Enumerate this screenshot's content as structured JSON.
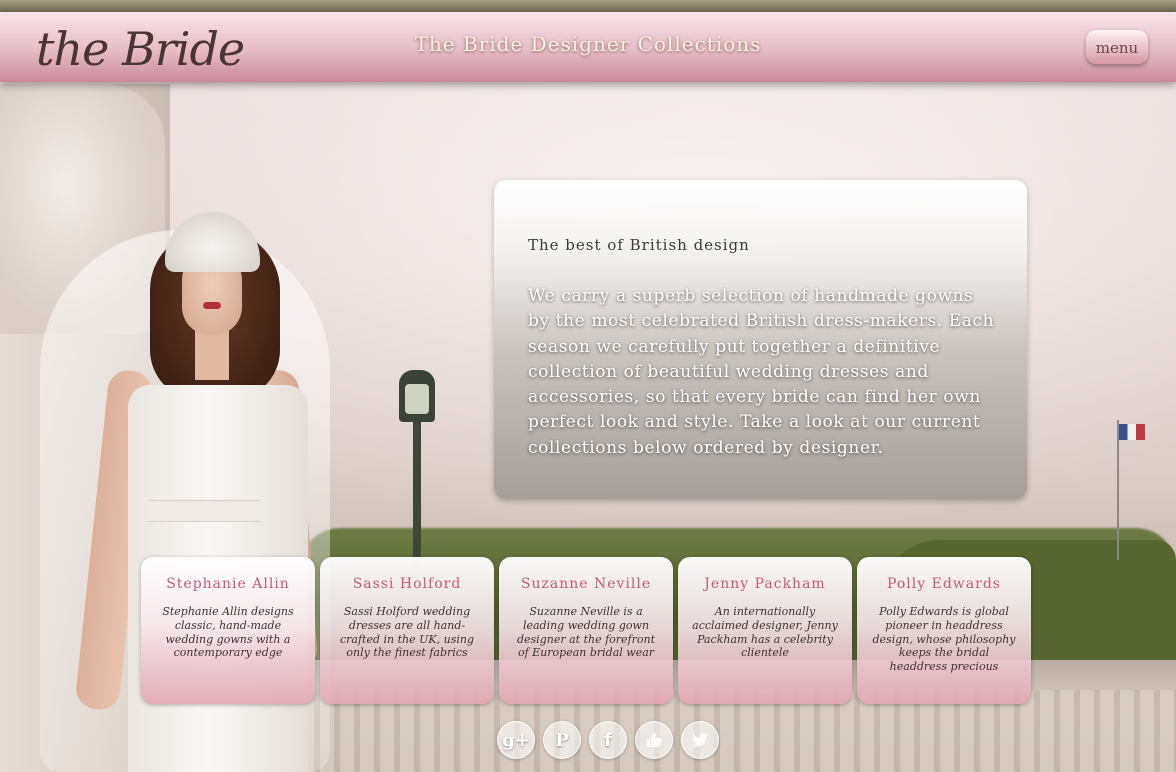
{
  "header": {
    "logo_text": "the Bride",
    "title": "The Bride Designer Collections",
    "menu_label": "menu"
  },
  "intro": {
    "heading": "The best of British design",
    "text": "We carry a superb selection of handmade gowns by the most celebrated British dress-makers. Each season we carefully put together a definitive collection of beautiful wedding dresses and accessories, so that every bride can find her own perfect look and style. Take a look at our current collections below ordered by designer."
  },
  "designers": [
    {
      "name": "Stephanie Allin",
      "description": "Stephanie Allin designs classic, hand-made wedding gowns with a contemporary edge"
    },
    {
      "name": "Sassi Holford",
      "description": "Sassi Holford wedding dresses are all hand-crafted in the UK, using only the finest fabrics"
    },
    {
      "name": "Suzanne Neville",
      "description": "Suzanne Neville is a leading wedding gown designer at the forefront of European bridal wear"
    },
    {
      "name": "Jenny Packham",
      "description": "An internationally acclaimed designer, Jenny Packham has a celebrity clientele"
    },
    {
      "name": "Polly Edwards",
      "description": "Polly Edwards is global pioneer in headdress design, whose philosophy keeps the bridal headdress precious"
    }
  ],
  "social": {
    "icons": [
      "google-plus-icon",
      "pinterest-icon",
      "facebook-icon",
      "like-icon",
      "twitter-icon"
    ],
    "google_plus_glyph": "g+",
    "pinterest_glyph": "P",
    "facebook_glyph": "f"
  },
  "colors": {
    "header_pink": "#e7bcc6",
    "designer_name": "#c25b72",
    "title_text": "#fbf3dd"
  }
}
